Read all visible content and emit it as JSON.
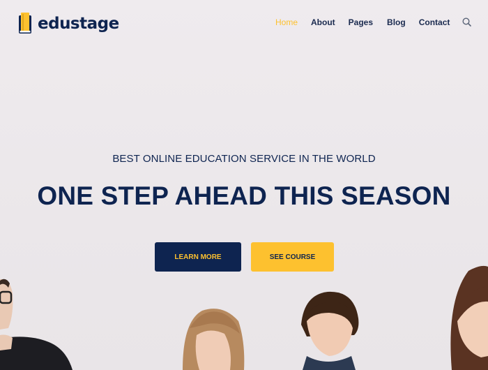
{
  "brand": {
    "name": "edustage",
    "logo_icon": "book-icon",
    "accent": "#fdc12f",
    "primary": "#0e2450"
  },
  "nav": {
    "items": [
      {
        "label": "Home",
        "active": true
      },
      {
        "label": "About",
        "active": false
      },
      {
        "label": "Pages",
        "active": false
      },
      {
        "label": "Blog",
        "active": false
      },
      {
        "label": "Contact",
        "active": false
      }
    ],
    "search_icon": "search-icon"
  },
  "hero": {
    "subtitle": "BEST ONLINE EDUCATION SERVICE IN THE WORLD",
    "title": "ONE STEP AHEAD THIS SEASON",
    "primary_button": "LEARN MORE",
    "secondary_button": "SEE COURSE"
  }
}
